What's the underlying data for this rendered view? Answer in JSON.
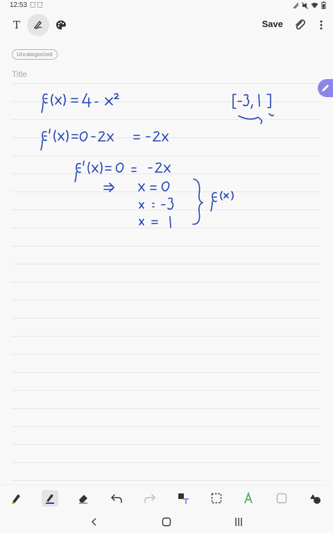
{
  "status_bar": {
    "time": "12:53",
    "icons": [
      "screenshot-icon",
      "cast-icon",
      "vibrate-icon",
      "mute-icon",
      "wifi-icon",
      "battery-icon"
    ]
  },
  "toolbar": {
    "text_tool_label": "T",
    "save_label": "Save",
    "icons": [
      "text-icon",
      "pen-icon",
      "palette-icon",
      "attach-icon",
      "more-icon"
    ]
  },
  "note": {
    "category": "Uncategorized",
    "title_placeholder": "Title"
  },
  "bottom_toolbar": {
    "icons": [
      "pen-style-icon",
      "highlighter-icon",
      "eraser-icon",
      "undo-icon",
      "redo-icon",
      "convert-text-icon",
      "select-icon",
      "shape-recognize-icon",
      "color-icon",
      "shapes-icon"
    ]
  },
  "nav_bar": {
    "icons": [
      "back-icon",
      "home-icon",
      "recents-icon"
    ]
  },
  "colors": {
    "ink": "#1f3fb3",
    "accent": "#8d86e8",
    "background": "#f8f8f8"
  }
}
